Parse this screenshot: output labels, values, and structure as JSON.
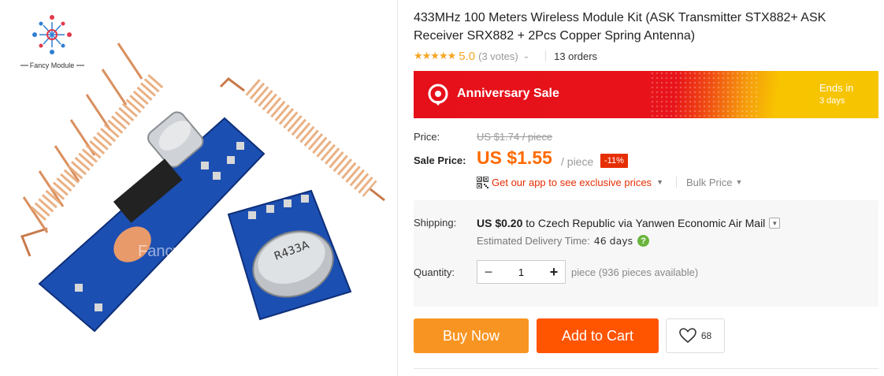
{
  "brand": {
    "logo_text": "Fancy Module",
    "watermark": "Fancy Module"
  },
  "product": {
    "title": "433MHz 100 Meters Wireless Module Kit (ASK Transmitter STX882+ ASK Receiver SRX882 + 2Pcs Copper Spring Antenna)",
    "rating": {
      "stars": "★★★★★",
      "value": "5.0",
      "votes": "(3 votes)",
      "orders": "13 orders"
    },
    "image_icon": "product-photo"
  },
  "banner": {
    "label": "Anniversary Sale",
    "ends_label": "Ends in",
    "ends_value": "3 days",
    "icon": "location-pin-icon"
  },
  "pricing": {
    "price_label": "Price:",
    "original_price": "US $1.74 / piece",
    "sale_label": "Sale Price:",
    "sale_price": "US $1.55",
    "unit": "/ piece",
    "discount": "-11%",
    "app_link": "Get our app to see exclusive prices",
    "bulk_price": "Bulk Price"
  },
  "shipping": {
    "label": "Shipping:",
    "cost": "US $0.20",
    "to_word": "to",
    "country": "Czech Republic",
    "via_word": "via",
    "carrier": "Yanwen Economic Air Mail",
    "delivery_label": "Estimated Delivery Time:",
    "delivery_value": "46 days"
  },
  "quantity": {
    "label": "Quantity:",
    "value": "1",
    "minus": "−",
    "plus": "+",
    "available": "piece (936 pieces available)"
  },
  "actions": {
    "buy_now": "Buy Now",
    "add_to_cart": "Add to Cart",
    "wishlist_count": "68"
  },
  "colors": {
    "accent_orange": "#ff6a00",
    "buy_now": "#f89522",
    "add_to_cart": "#ff5400",
    "banner_red": "#e5101a",
    "banner_yellow": "#f8c400",
    "discount": "#e62e04"
  }
}
